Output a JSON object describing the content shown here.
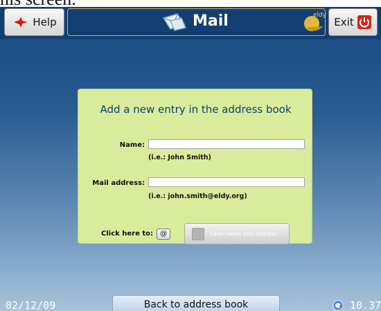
{
  "top_cut_text": "his screen.",
  "header": {
    "help_label": "Help",
    "title": "Mail",
    "exit_label": "Exit",
    "logo_text": "eldy"
  },
  "form": {
    "title": "Add a new entry in the address book",
    "name_label": "Name:",
    "name_value": "",
    "name_hint": "(i.e.: John Smith)",
    "mail_label": "Mail address:",
    "mail_value": "",
    "mail_hint": "(i.e.: john.smith@eldy.org)",
    "click_label": "Click here to:",
    "at_label": "@",
    "save_label": "Save name and address"
  },
  "footer": {
    "date": "02/12/09",
    "back_label": "Back to address book",
    "time": "10.37"
  },
  "colors": {
    "header_bg": "#123f73",
    "panel_bg": "#d9ec9c",
    "title_color": "#0f3f6e"
  }
}
